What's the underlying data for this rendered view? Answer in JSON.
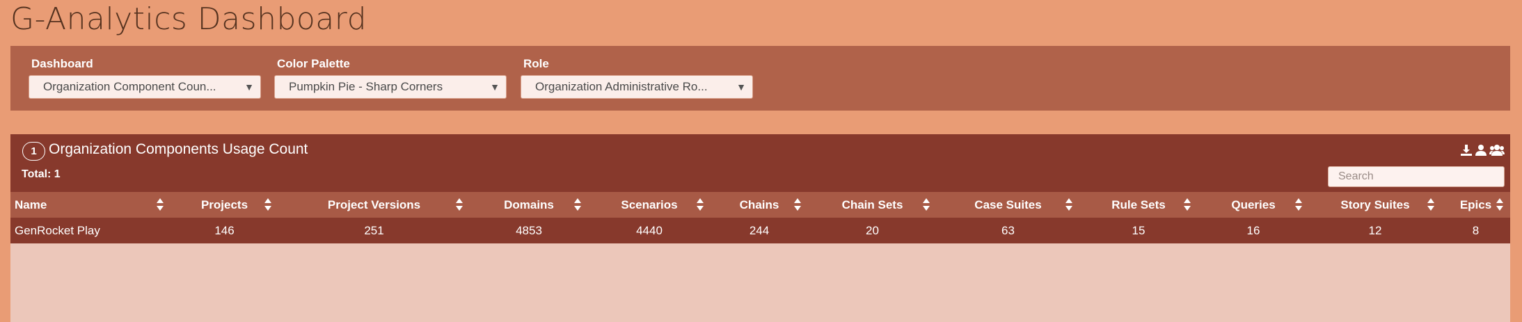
{
  "page": {
    "title": "G-Analytics Dashboard"
  },
  "filters": [
    {
      "label": "Dashboard",
      "value": "Organization Component Coun..."
    },
    {
      "label": "Color Palette",
      "value": "Pumpkin Pie - Sharp Corners"
    },
    {
      "label": "Role",
      "value": "Organization Administrative Ro..."
    }
  ],
  "panel": {
    "number": "1",
    "title": "Organization Components Usage Count",
    "total": "Total: 1",
    "search_placeholder": "Search",
    "icons": [
      "download-icon",
      "user-icon",
      "users-icon"
    ]
  },
  "table": {
    "columns": [
      "Name",
      "Projects",
      "Project Versions",
      "Domains",
      "Scenarios",
      "Chains",
      "Chain Sets",
      "Case Suites",
      "Rule Sets",
      "Queries",
      "Story Suites",
      "Epics"
    ],
    "rows": [
      [
        "GenRocket Play",
        "146",
        "251",
        "4853",
        "4440",
        "244",
        "20",
        "63",
        "15",
        "16",
        "12",
        "8"
      ]
    ]
  },
  "colors": {
    "page_bg": "#e99c75",
    "filter_bar": "#b0624a",
    "panel_header": "#87392c",
    "table_header": "#a85a46",
    "panel_body": "#ecc7ba"
  }
}
